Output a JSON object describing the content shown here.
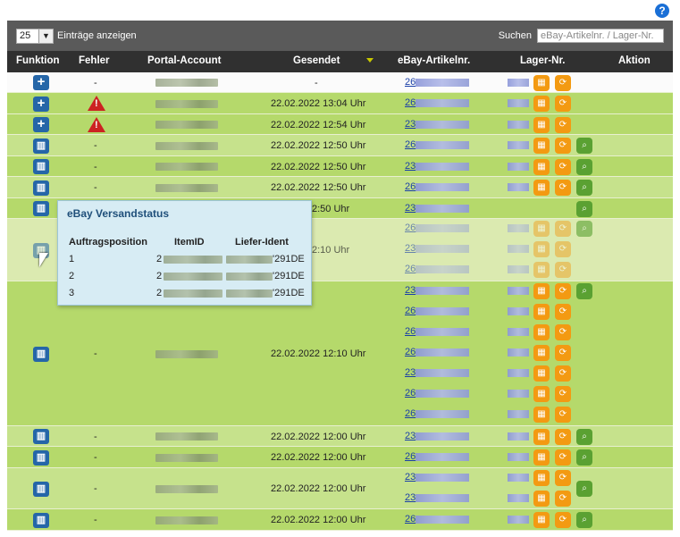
{
  "help_icon": "?",
  "toolbar": {
    "page_size": "25",
    "page_size_label": "Einträge anzeigen",
    "search_label": "Suchen",
    "search_placeholder": "eBay-Artikelnr. / Lager-Nr."
  },
  "columns": [
    "Funktion",
    "Fehler",
    "Portal-Account",
    "Gesendet",
    "eBay-Artikelnr.",
    "Lager-Nr.",
    "Aktion"
  ],
  "rows": [
    {
      "fehler": "-",
      "gesendet": "-",
      "ebay_prefix": "26",
      "icon": "plus"
    },
    {
      "fehler": "",
      "gesendet": "22.02.2022 13:04 Uhr",
      "ebay_prefix": "26",
      "icon": "plus"
    },
    {
      "fehler": "",
      "gesendet": "22.02.2022 12:54 Uhr",
      "ebay_prefix": "23",
      "icon": "plus"
    },
    {
      "fehler": "-",
      "gesendet": "22.02.2022 12:50 Uhr",
      "ebay_prefix": "26",
      "icon": "doc"
    },
    {
      "fehler": "-",
      "gesendet": "22.02.2022 12:50 Uhr",
      "ebay_prefix": "23",
      "icon": "doc"
    },
    {
      "fehler": "-",
      "gesendet": "22.02.2022 12:50 Uhr",
      "ebay_prefix": "26",
      "icon": "doc"
    },
    {
      "fehler": "",
      "gesendet": "22.02.2022 12:50 Uhr",
      "ebay_prefix": "23",
      "icon": "doc"
    },
    {
      "fehler": "",
      "gesendet": "22.02.2022 12:10 Uhr",
      "ebay_prefix": "26",
      "icon": "doc"
    },
    {
      "fehler": "-",
      "gesendet": "22.02.2022 12:10 Uhr",
      "ebay_prefix": "23",
      "icon": "doc"
    },
    {
      "fehler": "-",
      "gesendet": "22.02.2022 12:00 Uhr",
      "ebay_prefix": "23",
      "icon": "doc"
    },
    {
      "fehler": "-",
      "gesendet": "22.02.2022 12:00 Uhr",
      "ebay_prefix": "26",
      "icon": "doc"
    },
    {
      "fehler": "-",
      "gesendet": "22.02.2022 12:00 Uhr",
      "ebay_prefix": "23",
      "icon": "doc"
    },
    {
      "fehler": "-",
      "gesendet": "22.02.2022 12:00 Uhr",
      "ebay_prefix": "26",
      "icon": "doc"
    }
  ],
  "multi_links": {
    "row7": [
      "26",
      "23",
      "26"
    ],
    "row8": [
      "23",
      "26",
      "26",
      "26",
      "23",
      "26",
      "26"
    ],
    "row11": [
      "23",
      "23"
    ]
  },
  "popup": {
    "title": "eBay Versandstatus",
    "headers": [
      "Auftragsposition",
      "ItemID",
      "Liefer-Ident"
    ],
    "lines": [
      {
        "pos": "1",
        "item": "2",
        "ident": "'291DE"
      },
      {
        "pos": "2",
        "item": "2",
        "ident": "'291DE"
      },
      {
        "pos": "3",
        "item": "2",
        "ident": "'291DE"
      }
    ]
  }
}
